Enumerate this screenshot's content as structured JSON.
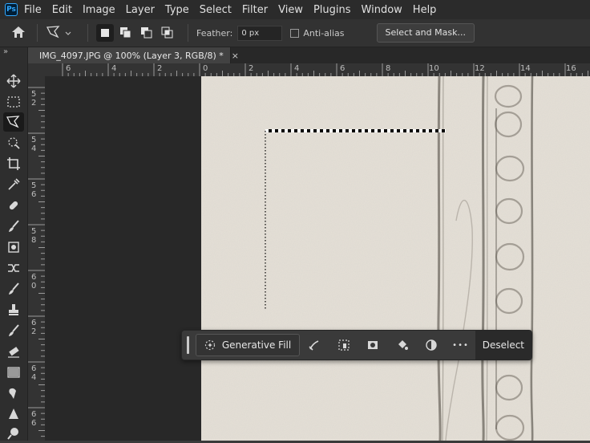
{
  "app": {
    "logo_text": "Ps"
  },
  "menu": [
    "File",
    "Edit",
    "Image",
    "Layer",
    "Type",
    "Select",
    "Filter",
    "View",
    "Plugins",
    "Window",
    "Help"
  ],
  "options": {
    "feather_label": "Feather:",
    "feather_value": "0 px",
    "anti_alias_label": "Anti-alias",
    "select_mask_label": "Select and Mask..."
  },
  "tab": {
    "title": "IMG_4097.JPG @ 100% (Layer 3, RGB/8) *",
    "close": "×"
  },
  "toolbar": {
    "collapse": "»"
  },
  "ruler": {
    "h_labels": [
      "6",
      "4",
      "2",
      "0",
      "2",
      "4",
      "6",
      "8",
      "10",
      "12",
      "14",
      "16"
    ],
    "v_labels": [
      "52",
      "54",
      "56",
      "58",
      "60",
      "62",
      "64",
      "66"
    ]
  },
  "context_bar": {
    "generative_fill_label": "Generative Fill",
    "more_label": "•••",
    "deselect_label": "Deselect"
  },
  "colors": {
    "accent": "#31a8ff",
    "canvas": "#e5e0d7",
    "ui_dark": "#2b2b2b"
  }
}
